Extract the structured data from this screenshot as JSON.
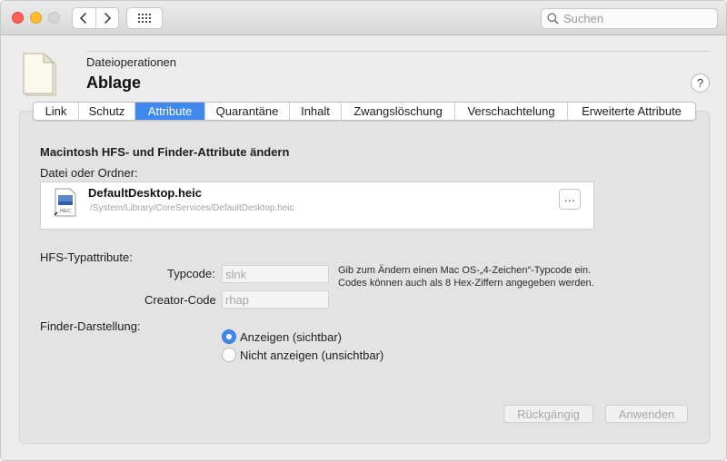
{
  "toolbar": {
    "search_placeholder": "Suchen",
    "back_icon": "chevron-left-icon",
    "forward_icon": "chevron-right-icon",
    "grid_icon": "grid-icon"
  },
  "header": {
    "subtitle": "Dateioperationen",
    "title": "Ablage",
    "help_label": "?"
  },
  "tabs": [
    {
      "label": "Link",
      "active": false
    },
    {
      "label": "Schutz",
      "active": false
    },
    {
      "label": "Attribute",
      "active": true
    },
    {
      "label": "Quarantäne",
      "active": false
    },
    {
      "label": "Inhalt",
      "active": false
    },
    {
      "label": "Zwangslöschung",
      "active": false
    },
    {
      "label": "Verschachtelung",
      "active": false
    },
    {
      "label": "Erweiterte Attribute",
      "active": false
    }
  ],
  "main": {
    "section_title": "Macintosh HFS- und Finder-Attribute ändern",
    "file_label": "Datei oder Ordner:",
    "file": {
      "name": "DefaultDesktop.heic",
      "path": "/System/Library/CoreServices/DefaultDesktop.heic",
      "icon_text": "HEIC",
      "more_label": "…"
    },
    "hfs_label": "HFS-Typattribute:",
    "typcode_label": "Typcode:",
    "typcode_value": "slnk",
    "creator_label": "Creator-Code",
    "creator_value": "rhap",
    "hint": "Gib zum Ändern einen Mac OS-„4-Zeichen“-Typcode ein. Codes können auch als 8 Hex-Ziffern angegeben werden.",
    "finder_label": "Finder-Darstellung:",
    "radio_show": "Anzeigen (sichtbar)",
    "radio_hide": "Nicht anzeigen (unsichtbar)",
    "undo_label": "Rückgängig",
    "apply_label": "Anwenden"
  },
  "colors": {
    "accent": "#3f88ee",
    "close": "#fe5f57",
    "minimize": "#febc2e"
  }
}
